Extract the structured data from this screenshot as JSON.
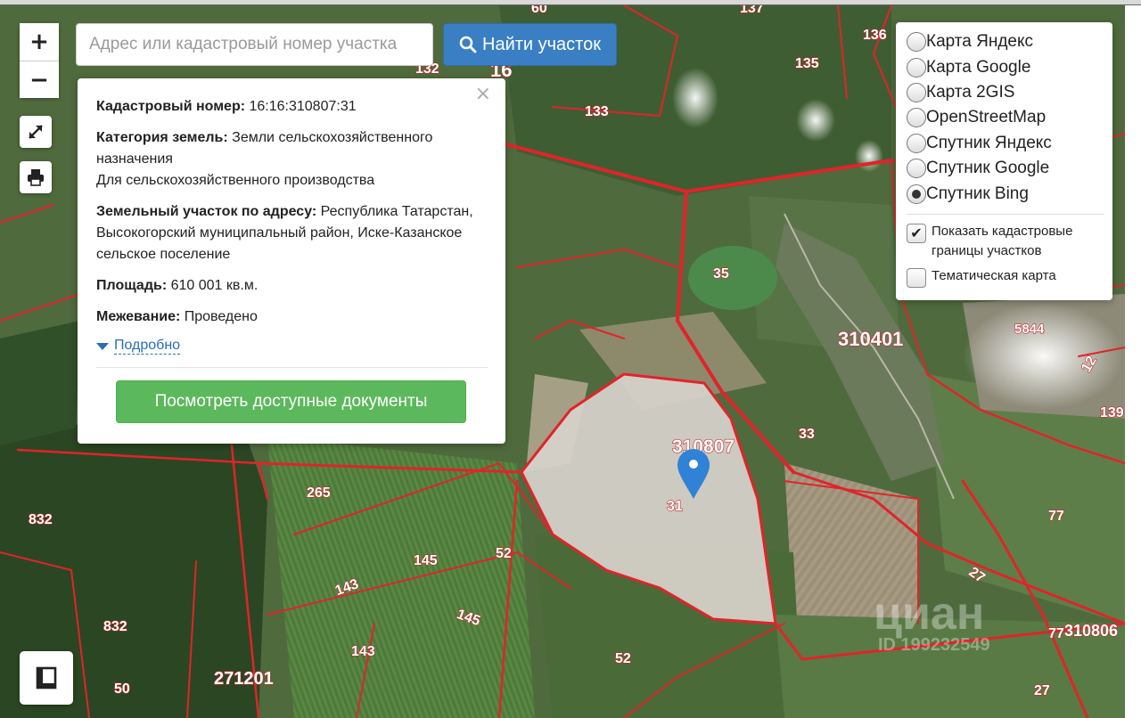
{
  "search": {
    "placeholder": "Адрес или кадастровый номер участка",
    "button_label": "Найти участок"
  },
  "zoom": {
    "in_label": "+",
    "out_label": "−"
  },
  "popup": {
    "close_label": "×",
    "cadastral_label": "Кадастровый номер:",
    "cadastral_value": "16:16:310807:31",
    "category_label": "Категория земель:",
    "category_value": "Земли сельскохозяйственного назначения",
    "usage_value": "Для сельскохозяйственного производства",
    "address_label": "Земельный участок по адресу:",
    "address_value": "Республика Татарстан, Высокогорский муниципальный район, Иске-Казанское сельское поселение",
    "area_label": "Площадь:",
    "area_value": "610 001 кв.м.",
    "survey_label": "Межевание:",
    "survey_value": "Проведено",
    "details_label": "Подробно",
    "docs_button_label": "Посмотреть доступные документы"
  },
  "layers": {
    "options": [
      {
        "label": "Карта Яндекс",
        "selected": false
      },
      {
        "label": "Карта Google",
        "selected": false
      },
      {
        "label": "Карта 2GIS",
        "selected": false
      },
      {
        "label": "OpenStreetMap",
        "selected": false
      },
      {
        "label": "Спутник Яндекс",
        "selected": false
      },
      {
        "label": "Спутник Google",
        "selected": false
      },
      {
        "label": "Спутник Bing",
        "selected": true
      }
    ],
    "show_boundaries_label": "Показать кадастровые границы участков",
    "show_boundaries_checked": true,
    "thematic_label": "Тематическая карта",
    "thematic_checked": false
  },
  "parcel_labels": {
    "l136": "136",
    "l137": "137",
    "l135": "135",
    "l133": "133",
    "l132": "132",
    "l16": "16",
    "l35": "35",
    "l310401": "310401",
    "l5844": "5844",
    "l12": "12",
    "l139": "139",
    "l33": "33",
    "l310807": "310807",
    "l31": "31",
    "l265": "265",
    "l832a": "832",
    "l145a": "145",
    "l52a": "52",
    "l143a": "143",
    "l145b": "145",
    "l832b": "832",
    "l143b": "143",
    "l52b": "52",
    "l271201": "271201",
    "l50": "50",
    "l77a": "77",
    "l27a": "27",
    "l77b": "77",
    "l310806": "310806",
    "l27b": "27",
    "l60": "60"
  },
  "watermark": {
    "brand": "циан",
    "id_text": "ID 199232549"
  },
  "colors": {
    "boundary": "#e0242a",
    "selected_parcel": "#d8d2cc",
    "marker": "#2f82d6",
    "search_button": "#3a7fc4",
    "docs_button": "#5cb85c"
  }
}
